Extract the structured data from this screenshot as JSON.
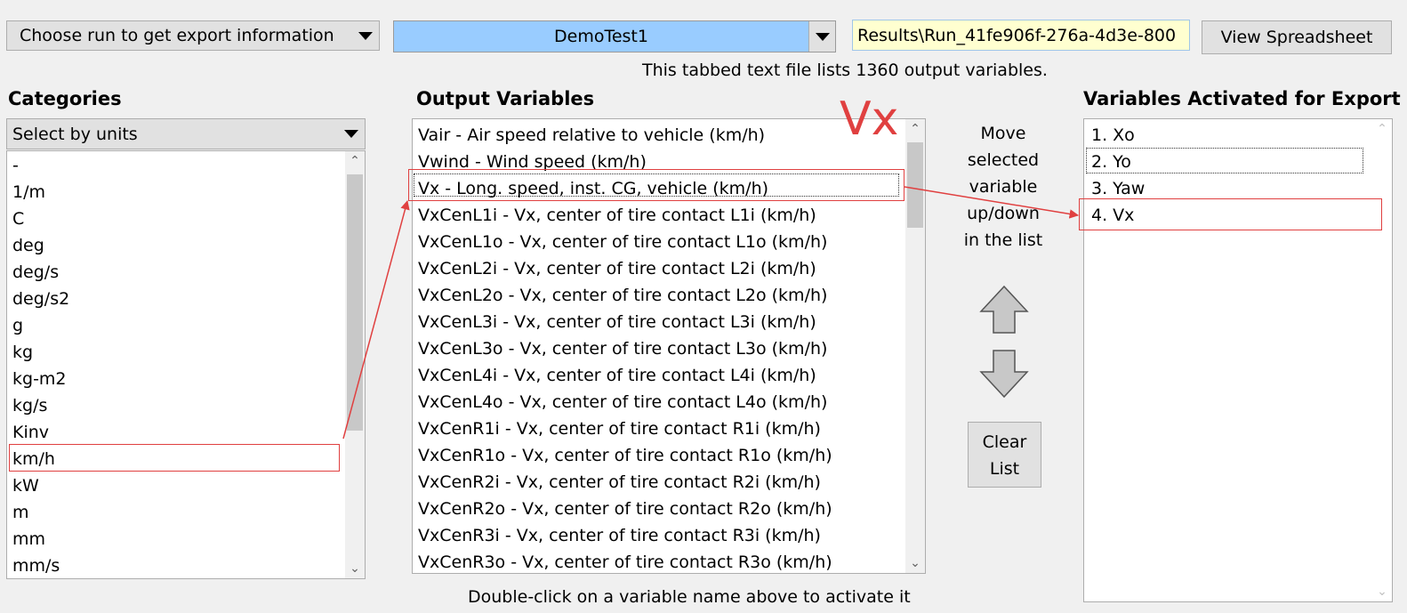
{
  "toolbar": {
    "run_combo_label": "Choose run to get export information",
    "run_selected": "DemoTest1",
    "results_path": "Results\\Run_41fe906f-276a-4d3e-800",
    "view_spreadsheet_label": "View Spreadsheet",
    "info_text": "This tabbed text file lists 1360 output variables."
  },
  "categories": {
    "heading": "Categories",
    "filter_selected": "Select by units",
    "items": [
      "-",
      "1/m",
      "C",
      "deg",
      "deg/s",
      "deg/s2",
      "g",
      "kg",
      "kg-m2",
      "kg/s",
      "Kinv",
      "km/h",
      "kW",
      "m",
      "mm",
      "mm/s"
    ],
    "selected": "km/h"
  },
  "output_variables": {
    "heading": "Output Variables",
    "items": [
      "Vair - Air speed relative to vehicle (km/h)",
      "Vwind - Wind speed (km/h)",
      "Vx - Long. speed, inst. CG, vehicle (km/h)",
      "VxCenL1i - Vx, center of tire contact L1i (km/h)",
      "VxCenL1o - Vx, center of tire contact L1o (km/h)",
      "VxCenL2i - Vx, center of tire contact L2i (km/h)",
      "VxCenL2o - Vx, center of tire contact L2o (km/h)",
      "VxCenL3i - Vx, center of tire contact L3i (km/h)",
      "VxCenL3o - Vx, center of tire contact L3o (km/h)",
      "VxCenL4i - Vx, center of tire contact L4i (km/h)",
      "VxCenL4o - Vx, center of tire contact L4o (km/h)",
      "VxCenR1i - Vx, center of tire contact R1i (km/h)",
      "VxCenR1o - Vx, center of tire contact R1o (km/h)",
      "VxCenR2i - Vx, center of tire contact R2i (km/h)",
      "VxCenR2o - Vx, center of tire contact R2o (km/h)",
      "VxCenR3i - Vx, center of tire contact R3i (km/h)",
      "VxCenR3o - Vx, center of tire contact R3o (km/h)"
    ],
    "selected": "Vx - Long. speed, inst. CG, vehicle (km/h)",
    "annotation": "Vx",
    "hint": "Double-click on a variable name above to activate it"
  },
  "controls": {
    "move_text_lines": [
      "Move",
      "selected",
      "variable",
      "up/down",
      "in the list"
    ],
    "clear_lines": [
      "Clear",
      "List"
    ]
  },
  "export": {
    "heading": "Variables Activated for Export",
    "items": [
      "1. Xo",
      "2. Yo",
      "3. Yaw",
      "4. Vx"
    ]
  },
  "icons": {
    "combo_arrow": "triangle-down-icon",
    "move_up": "arrow-up-icon",
    "move_down": "arrow-down-icon"
  },
  "colors": {
    "annotation": "#e04040",
    "selected_run_bg": "#99ccff",
    "path_bg": "#ffffd0"
  }
}
